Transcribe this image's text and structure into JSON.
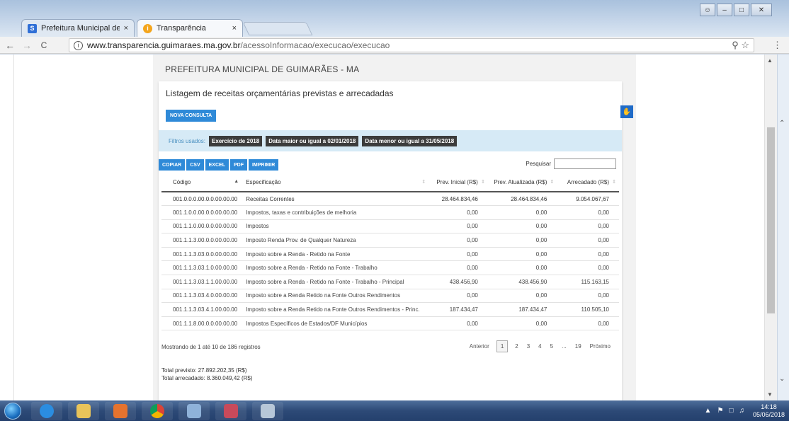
{
  "browser": {
    "tabs": [
      {
        "title": "Prefeitura Municipal de G",
        "close": "×",
        "favicon": "prefeitura-favicon",
        "active": false
      },
      {
        "title": "Transparência",
        "close": "×",
        "favicon": "transparencia-favicon",
        "active": true
      }
    ],
    "url_host": "www.transparencia.guimaraes.ma.gov.br",
    "url_path": "/acessoInformacao/execucao/execucao",
    "nav": {
      "back": "←",
      "forward": "→",
      "reload": "C"
    },
    "window_controls": {
      "minimize": "–",
      "maximize": "□",
      "close": "✕"
    }
  },
  "page": {
    "org_name": "PREFEITURA MUNICIPAL DE GUIMARÃES - MA",
    "panel_title": "Listagem de receitas orçamentárias previstas e arrecadadas",
    "new_query_label": "NOVA CONSULTA",
    "filters_label": "Filtros usados:",
    "filters": [
      "Exercício de 2018",
      "Data maior ou igual a 02/01/2018",
      "Data menor ou igual a 31/05/2018"
    ],
    "export_buttons": [
      "COPIAR",
      "CSV",
      "EXCEL",
      "PDF",
      "IMPRIMIR"
    ],
    "search_label": "Pesquisar",
    "columns": [
      "Código",
      "Especificação",
      "Prev. Inicial (R$)",
      "Prev. Atualizada (R$)",
      "Arrecadado (R$)"
    ],
    "rows": [
      {
        "codigo": "001.0.0.0.00.0.0.00.00.00",
        "especificacao": "Receitas Correntes",
        "prev_inicial": "28.464.834,46",
        "prev_atualizada": "28.464.834,46",
        "arrecadado": "9.054.067,67"
      },
      {
        "codigo": "001.1.0.0.00.0.0.00.00.00",
        "especificacao": "Impostos, taxas e contribuições de melhoria",
        "prev_inicial": "0,00",
        "prev_atualizada": "0,00",
        "arrecadado": "0,00"
      },
      {
        "codigo": "001.1.1.0.00.0.0.00.00.00",
        "especificacao": "Impostos",
        "prev_inicial": "0,00",
        "prev_atualizada": "0,00",
        "arrecadado": "0,00"
      },
      {
        "codigo": "001.1.1.3.00.0.0.00.00.00",
        "especificacao": "Imposto Renda Prov. de Qualquer Natureza",
        "prev_inicial": "0,00",
        "prev_atualizada": "0,00",
        "arrecadado": "0,00"
      },
      {
        "codigo": "001.1.1.3.03.0.0.00.00.00",
        "especificacao": "Imposto sobre a Renda - Retido na Fonte",
        "prev_inicial": "0,00",
        "prev_atualizada": "0,00",
        "arrecadado": "0,00"
      },
      {
        "codigo": "001.1.1.3.03.1.0.00.00.00",
        "especificacao": "Imposto sobre a Renda - Retido na Fonte - Trabalho",
        "prev_inicial": "0,00",
        "prev_atualizada": "0,00",
        "arrecadado": "0,00"
      },
      {
        "codigo": "001.1.1.3.03.1.1.00.00.00",
        "especificacao": "Imposto sobre a Renda - Retido na Fonte - Trabalho - Principal",
        "prev_inicial": "438.456,90",
        "prev_atualizada": "438.456,90",
        "arrecadado": "115.163,15"
      },
      {
        "codigo": "001.1.1.3.03.4.0.00.00.00",
        "especificacao": "Imposto sobre a Renda Retido na Fonte Outros Rendimentos",
        "prev_inicial": "0,00",
        "prev_atualizada": "0,00",
        "arrecadado": "0,00"
      },
      {
        "codigo": "001.1.1.3.03.4.1.00.00.00",
        "especificacao": "Imposto sobre a Renda Retido na Fonte Outros Rendimentos - Princ.",
        "prev_inicial": "187.434,47",
        "prev_atualizada": "187.434,47",
        "arrecadado": "110.505,10"
      },
      {
        "codigo": "001.1.1.8.00.0.0.00.00.00",
        "especificacao": "Impostos Específicos de Estados/DF Municípios",
        "prev_inicial": "0,00",
        "prev_atualizada": "0,00",
        "arrecadado": "0,00"
      }
    ],
    "info": "Mostrando de 1 até 10 de 186 registros",
    "pager": {
      "prev": "Anterior",
      "pages": [
        "1",
        "2",
        "3",
        "4",
        "5",
        "...",
        "19"
      ],
      "current": "1",
      "next": "Próximo"
    },
    "total_previsto": "Total previsto: 27.892.202,35 (R$)",
    "total_arrecadado": "Total arrecadado: 8.360.049,42 (R$)"
  },
  "taskbar": {
    "apps": [
      "ie-icon",
      "explorer-icon",
      "outlook-icon",
      "chrome-icon",
      "paint-icon",
      "snipping-tool-icon",
      "calculator-icon"
    ],
    "time": "14:18",
    "date": "05/06/2018"
  },
  "colors": {
    "accent": "#2f8ad8",
    "filter_bg": "#d6eaf6",
    "chip": "#3c3c3c",
    "taskbar": "#2d4a77"
  }
}
